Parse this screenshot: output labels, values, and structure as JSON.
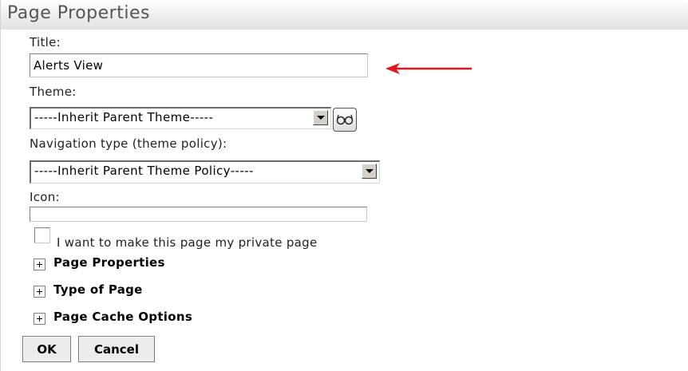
{
  "header": {
    "title": "Page Properties"
  },
  "form": {
    "title_label": "Title:",
    "title_value": "Alerts View",
    "theme_label": "Theme:",
    "theme_selected": "-----Inherit Parent Theme-----",
    "nav_label": "Navigation type (theme policy):",
    "nav_selected": "-----Inherit Parent Theme Policy-----",
    "icon_label": "Icon:",
    "icon_value": "",
    "private_label": "I want to make this page my private page",
    "private_checked": false
  },
  "sections": [
    {
      "label": "Page Properties",
      "icon": "plus-expand-icon"
    },
    {
      "label": "Type of Page",
      "icon": "plus-expand-icon"
    },
    {
      "label": "Page Cache Options",
      "icon": "plus-expand-icon"
    }
  ],
  "buttons": {
    "ok": "OK",
    "cancel": "Cancel"
  },
  "annotation": {
    "icon": "red-arrow-left-icon",
    "color": "#e8141c"
  }
}
